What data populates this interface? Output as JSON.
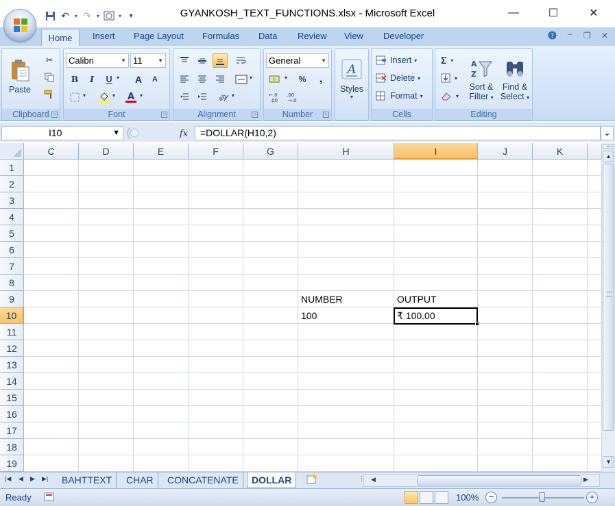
{
  "window": {
    "title": "GYANKOSH_TEXT_FUNCTIONS.xlsx - Microsoft Excel"
  },
  "ribbon": {
    "tabs": [
      "Home",
      "Insert",
      "Page Layout",
      "Formulas",
      "Data",
      "Review",
      "View",
      "Developer"
    ],
    "clipboard": {
      "paste": "Paste",
      "label": "Clipboard"
    },
    "font": {
      "name": "Calibri",
      "size": "11",
      "bold": "B",
      "italic": "I",
      "underline": "U",
      "grow": "A",
      "shrink": "A",
      "label": "Font"
    },
    "alignment": {
      "label": "Alignment"
    },
    "number": {
      "format": "General",
      "percent": "%",
      "comma": ",",
      "label": "Number"
    },
    "styles": {
      "label": "Styles"
    },
    "cells": {
      "insert": "Insert",
      "delete": "Delete",
      "format": "Format",
      "label": "Cells"
    },
    "editing": {
      "sum": "Σ",
      "sort1": "Sort &",
      "sort2": "Filter",
      "find1": "Find &",
      "find2": "Select",
      "label": "Editing"
    }
  },
  "formula_bar": {
    "name_box": "I10",
    "formula": "=DOLLAR(H10,2)"
  },
  "grid": {
    "columns": [
      "C",
      "D",
      "E",
      "F",
      "G",
      "H",
      "I",
      "J",
      "K"
    ],
    "selected_column": "I",
    "rows": [
      "1",
      "2",
      "3",
      "4",
      "5",
      "6",
      "7",
      "8",
      "9",
      "10",
      "11",
      "12",
      "13",
      "14",
      "15",
      "16",
      "17",
      "18",
      "19"
    ],
    "selected_row": "10",
    "cells": {
      "H9": "NUMBER",
      "I9": "OUTPUT",
      "H10": "100",
      "I10": "₹ 100.00"
    }
  },
  "sheet_tabs": {
    "tabs": [
      "BAHTTEXT",
      "CHAR",
      "CONCATENATE",
      "DOLLAR"
    ],
    "active": "DOLLAR"
  },
  "status_bar": {
    "ready": "Ready",
    "zoom": "100%"
  },
  "colors": {
    "ribbon_bg": "#dbe8f9",
    "selected_header": "#f9c36a",
    "ui_text": "#15428b"
  }
}
